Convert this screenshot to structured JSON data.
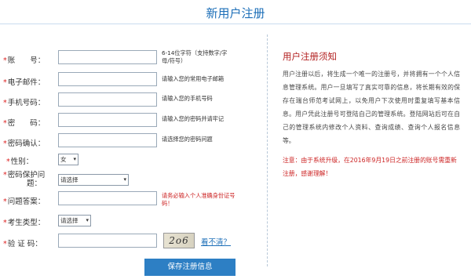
{
  "header": {
    "title": "新用户注册"
  },
  "form": {
    "account": {
      "label": "账　　号：",
      "value": "",
      "hint": "6-14位字符（支持数字/字母/符号）"
    },
    "email": {
      "label": "电子邮件：",
      "value": "",
      "hint": "请输入您的常用电子邮箱"
    },
    "phone": {
      "label": "手机号码：",
      "value": "",
      "hint": "请输入您的手机号码"
    },
    "password": {
      "label": "密　　码：",
      "value": "",
      "hint": "请输入您的密码并请牢记"
    },
    "confirm": {
      "label": "密码确认：",
      "value": "",
      "hint": "请选择您的密码问题"
    },
    "gender": {
      "label": "性别：",
      "selected": "女"
    },
    "question": {
      "label_line1": "密码保护问",
      "label_line2": "题：",
      "selected": "请选择"
    },
    "answer": {
      "label": "问题答案：",
      "value": "",
      "hint": "请务必输入个人准确身份证号码！"
    },
    "candidate_type": {
      "label": "考生类型：",
      "selected": "请选择"
    },
    "captcha": {
      "label": "验 证 码：",
      "value": "",
      "image_text": "2o6",
      "refresh_link": "看不清？"
    },
    "submit_label": "保存注册信息"
  },
  "notice": {
    "title": "用户注册须知",
    "body": "用户注册以后，将生成一个唯一的注册号，并将拥有一个个人信息管理系统。用户一旦填写了真实可靠的信息，将长期有效的保存在瑞台师范考试网上，以免用户下次使用时重复填写基本信息。用户凭此注册号可登陆自己的管理系统。登陆网站后可在自己的管理系统内修改个人资料、查询成绩、查询个人报名信息等。",
    "note": "注意：由于系统升级，在2016年9月19日之前注册的账号需重新注册，感谢理解！"
  },
  "colors": {
    "accent": "#2d7fc4",
    "title": "#1d6fb8",
    "required": "#dd2222",
    "warning": "#cc2222"
  }
}
